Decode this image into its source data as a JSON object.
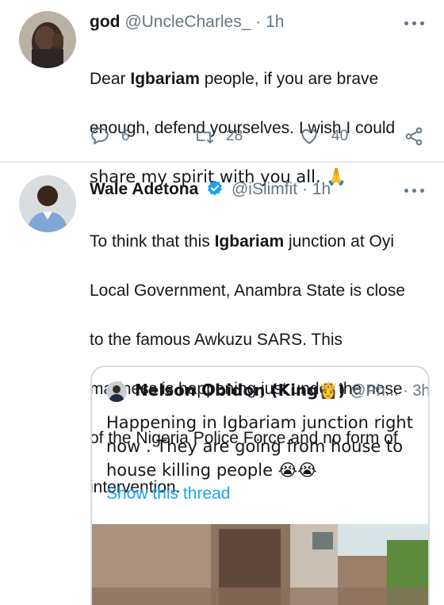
{
  "tweets": [
    {
      "author_name": "god",
      "handle": "@UncleCharles_",
      "separator": "·",
      "time": "1h",
      "text_lines": [
        {
          "pre": "Dear ",
          "bold": "Igbariam",
          "post": " people, if you are brave"
        },
        {
          "pre": "enough, defend yourselves. I wish I could",
          "bold": "",
          "post": ""
        },
        {
          "pre": "share my spirit with you all. 🙏",
          "bold": "",
          "post": ""
        }
      ],
      "actions": {
        "reply_count": "6",
        "retweet_count": "28",
        "like_count": "40"
      },
      "icons": {
        "reply": "reply-icon",
        "retweet": "retweet-icon",
        "like": "heart-icon",
        "share": "share-icon",
        "more": "more-icon"
      }
    },
    {
      "author_name": "Wale Adetona",
      "verified": true,
      "handle": "@iSlimfit",
      "separator": "·",
      "time": "1h",
      "text_lines": [
        {
          "pre": "To think that this ",
          "bold": "Igbariam",
          "post": " junction at Oyi"
        },
        {
          "pre": "Local Government, Anambra State is close",
          "bold": "",
          "post": ""
        },
        {
          "pre": "to the famous Awkuzu SARS. This",
          "bold": "",
          "post": ""
        },
        {
          "pre": "madness is happening just under the nose",
          "bold": "",
          "post": ""
        },
        {
          "pre": "of the Nigeria Police Force and no form of",
          "bold": "",
          "post": ""
        },
        {
          "pre": "intervention.",
          "bold": "",
          "post": ""
        }
      ],
      "quoted_tweet": {
        "author_name": "Nelson Obidon (King👸)",
        "handle": "@Ph...",
        "separator": "·",
        "time": "3h",
        "text": "Happening in Igbariam junction right\nnow . They are going from house to\nhouse killing people 😭😭",
        "show_thread_label": "Show this thread"
      }
    }
  ],
  "colors": {
    "accent": "#1da1f2",
    "secondary_text": "#657786",
    "divider": "#e6ecf0",
    "verified": "#1da1f2"
  }
}
